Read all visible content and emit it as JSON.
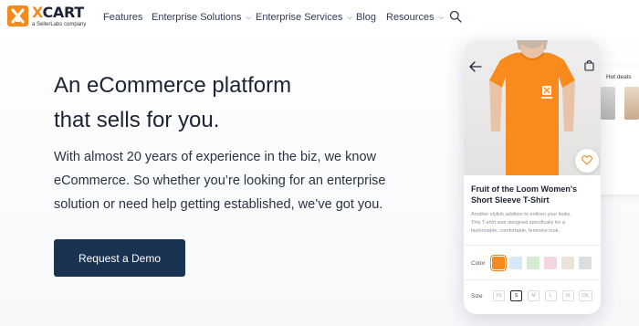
{
  "brand": {
    "name_prefix": "X",
    "name_suffix": "CART",
    "tagline": "a SellerLabs company",
    "accent_color": "#f28a1e"
  },
  "nav": {
    "items": [
      {
        "label": "Features",
        "dropdown": false
      },
      {
        "label": "Enterprise Solutions",
        "dropdown": true
      },
      {
        "label": "Enterprise Services",
        "dropdown": true
      },
      {
        "label": "Blog",
        "dropdown": false
      },
      {
        "label": "Resources",
        "dropdown": true
      }
    ],
    "search_icon": "search-icon"
  },
  "hero": {
    "title_lines": [
      "An eCommerce platform",
      "that sells for you."
    ],
    "body_lines": [
      "With almost 20 years of experience in the biz, we know",
      "eCommerce. So whether you’re looking for an enterprise",
      "solution or need help getting established, we’ve got you."
    ],
    "cta_label": "Request a Demo",
    "cta_color": "#1b3352"
  },
  "side_card": {
    "label": "Hot deals"
  },
  "product": {
    "shirt_color": "#f98a1c",
    "title_lines": [
      "Fruit of the Loom Women's",
      "Short Sleeve T-Shirt"
    ],
    "description_lines": [
      "Another stylish addition to enliven your looks.",
      "This T-shirt was designed specifically for a",
      "fashionable, comfortable, feminine look."
    ],
    "color_label": "Color",
    "colors": [
      "#f58b1f",
      "#d7e8f7",
      "#d5ecd3",
      "#f6d6de",
      "#ece3d7",
      "#dcdde1"
    ],
    "selected_color_index": 0,
    "size_label": "Size",
    "sizes": [
      "XS",
      "S",
      "M",
      "L",
      "XL",
      "2XL"
    ],
    "selected_size_index": 1,
    "carousel_pages": 4,
    "carousel_active": 1
  }
}
